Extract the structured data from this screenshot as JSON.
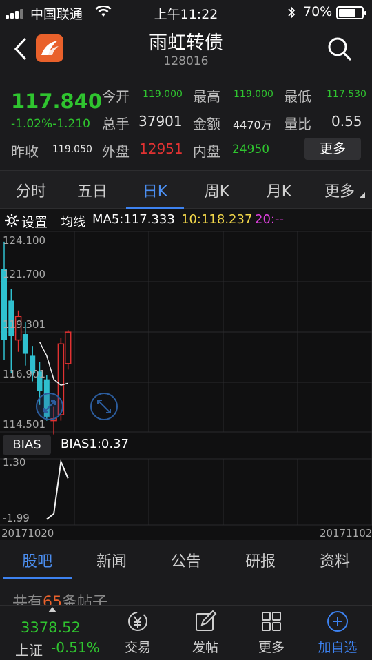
{
  "status_bar": {
    "carrier": "中国联通",
    "time": "上午11:22",
    "battery": "70%"
  },
  "header": {
    "title": "雨虹转债",
    "code": "128016"
  },
  "quote": {
    "price": "117.840",
    "change_pct": "-1.02%",
    "change": "-1.210",
    "prev_close_label": "昨收",
    "prev_close": "119.050",
    "open_label": "今开",
    "open": "119.000",
    "high_label": "最高",
    "high": "119.000",
    "low_label": "最低",
    "low": "117.530",
    "volume_label": "总手",
    "volume": "37901",
    "amount_label": "金额",
    "amount": "4470万",
    "vol_ratio_label": "量比",
    "vol_ratio": "0.55",
    "outer_label": "外盘",
    "outer": "12951",
    "inner_label": "内盘",
    "inner": "24950",
    "more_button": "更多"
  },
  "tabs": [
    "分时",
    "五日",
    "日K",
    "周K",
    "月K",
    "更多"
  ],
  "chart_toolbar": {
    "settings": "设置",
    "ma_label": "均线",
    "ma5": "MA5:117.333",
    "ma10": "10:118.237",
    "ma20": "20:--"
  },
  "chart_axis": {
    "y_labels": [
      "124.100",
      "121.700",
      "119.301",
      "116.901",
      "114.501"
    ],
    "bias_tag": "BIAS",
    "bias_value": "BIAS1:0.37",
    "bias_labels": [
      "1.30",
      "-1.99"
    ],
    "date_start": "20171020",
    "date_end": "20171102"
  },
  "chart_data": {
    "type": "candlestick",
    "ylim": [
      114.501,
      124.1
    ],
    "candles": [
      {
        "open": 122.6,
        "close": 119.0,
        "high": 124.0,
        "low": 118.0
      },
      {
        "open": 121.0,
        "close": 119.2,
        "high": 121.6,
        "low": 117.3
      },
      {
        "open": 119.0,
        "close": 120.2,
        "high": 120.5,
        "low": 118.4
      },
      {
        "open": 119.3,
        "close": 118.3,
        "high": 119.9,
        "low": 117.7
      },
      {
        "open": 118.2,
        "close": 117.3,
        "high": 118.7,
        "low": 116.9
      },
      {
        "open": 117.4,
        "close": 116.4,
        "high": 117.9,
        "low": 115.7
      },
      {
        "open": 117.0,
        "close": 115.1,
        "high": 117.2,
        "low": 114.9
      },
      {
        "open": 114.9,
        "close": 115.0,
        "high": 115.6,
        "low": 114.2
      },
      {
        "open": 115.2,
        "close": 118.8,
        "high": 119.1,
        "low": 114.9
      },
      {
        "open": 117.8,
        "close": 119.4,
        "high": 119.5,
        "low": 117.5
      }
    ],
    "ma5": [
      {
        "i": 5,
        "v": 118.9
      },
      {
        "i": 6,
        "v": 118.2
      },
      {
        "i": 7,
        "v": 117.0
      },
      {
        "i": 8,
        "v": 116.7
      },
      {
        "i": 9,
        "v": 116.8
      }
    ],
    "bias1": [
      {
        "i": 6,
        "v": -1.9
      },
      {
        "i": 7,
        "v": -1.6
      },
      {
        "i": 8,
        "v": 1.3
      },
      {
        "i": 9,
        "v": 0.37
      }
    ],
    "bias_ylim": [
      -1.99,
      1.3
    ]
  },
  "sub_tabs": [
    "股吧",
    "新闻",
    "公告",
    "研报",
    "资料"
  ],
  "posts_text": "共有",
  "posts_count": "65",
  "posts_suffix": "条帖子",
  "bottom_bar": {
    "index_value": "3378.52",
    "index_name": "上证",
    "index_change": "-0.51%",
    "items": [
      "交易",
      "发帖",
      "更多",
      "加自选"
    ]
  },
  "colors": {
    "up": "#e23232",
    "down": "#2fc0cf",
    "accent": "#3d82f0",
    "green": "#2fc42f"
  }
}
